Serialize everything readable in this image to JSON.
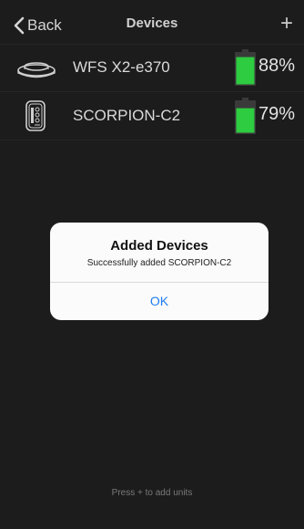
{
  "nav": {
    "back_label": "Back",
    "title": "Devices",
    "add_label": "+"
  },
  "devices": [
    {
      "name": "WFS X2-e370",
      "battery_percent_label": "88%",
      "battery_level": 0.88,
      "icon": "sensor-disc-icon"
    },
    {
      "name": "SCORPION-C2",
      "battery_percent_label": "79%",
      "battery_level": 0.79,
      "icon": "scorpion-device-icon"
    }
  ],
  "dialog": {
    "title": "Added Devices",
    "message": "Successfully added SCORPION-C2",
    "ok_label": "OK"
  },
  "hint": "Press + to add units",
  "colors": {
    "background": "#1c1c1c",
    "battery_fill": "#2ecc40",
    "link_blue": "#1e7cf0"
  }
}
